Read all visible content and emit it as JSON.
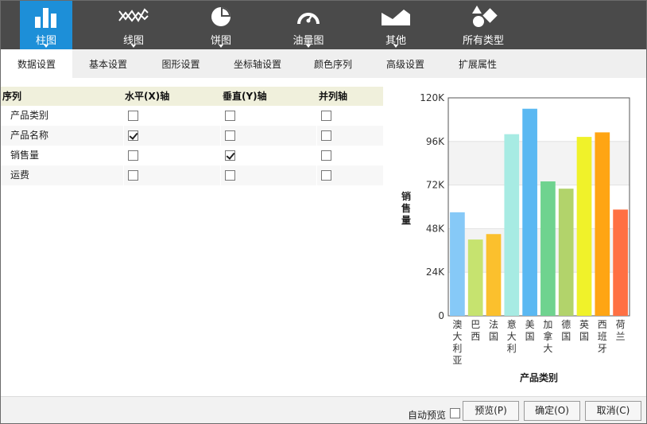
{
  "toolbar": {
    "items": [
      {
        "label": "柱图",
        "icon": "bar-chart-icon",
        "active": true
      },
      {
        "label": "线图",
        "icon": "line-chart-icon",
        "active": false
      },
      {
        "label": "饼图",
        "icon": "pie-chart-icon",
        "active": false
      },
      {
        "label": "油量图",
        "icon": "gauge-chart-icon",
        "active": false
      },
      {
        "label": "其他",
        "icon": "area-chart-icon",
        "active": false
      },
      {
        "label": "所有类型",
        "icon": "shapes-icon",
        "active": false
      }
    ]
  },
  "tabs": [
    {
      "label": "数据设置",
      "active": true
    },
    {
      "label": "基本设置",
      "active": false
    },
    {
      "label": "图形设置",
      "active": false
    },
    {
      "label": "坐标轴设置",
      "active": false
    },
    {
      "label": "颜色序列",
      "active": false
    },
    {
      "label": "高级设置",
      "active": false
    },
    {
      "label": "扩展属性",
      "active": false
    }
  ],
  "grid": {
    "headers": [
      "序列",
      "水平(X)轴",
      "垂直(Y)轴",
      "并列轴"
    ],
    "rows": [
      {
        "name": "产品类别",
        "x": false,
        "y": false,
        "parallel": false
      },
      {
        "name": "产品名称",
        "x": true,
        "y": false,
        "parallel": false
      },
      {
        "name": "销售量",
        "x": false,
        "y": true,
        "parallel": false
      },
      {
        "name": "运费",
        "x": false,
        "y": false,
        "parallel": false
      }
    ]
  },
  "chart_data": {
    "type": "bar",
    "categories": [
      "澳大利亚",
      "巴西",
      "法国",
      "意大利",
      "美国",
      "加拿大",
      "德国",
      "英国",
      "西班牙",
      "荷兰"
    ],
    "values": [
      57000,
      42000,
      45000,
      100000,
      114000,
      74000,
      70000,
      98500,
      101000,
      58500
    ],
    "colors": [
      "#86c9f7",
      "#c6e36f",
      "#fbc02d",
      "#a7ebe3",
      "#5ab8f2",
      "#6fd38f",
      "#b2d36b",
      "#f0f22a",
      "#ffa513",
      "#ff7043"
    ],
    "ylim": [
      0,
      120000
    ],
    "yticks": [
      0,
      24000,
      48000,
      72000,
      96000,
      120000
    ],
    "ytick_labels": [
      "0",
      "24K",
      "48K",
      "72K",
      "96K",
      "120K"
    ],
    "xlabel": "产品类别",
    "ylabel": "销售量",
    "grid": true,
    "alternating_bands": true
  },
  "footer": {
    "auto_preview_label": "自动预览",
    "auto_preview_checked": false,
    "preview_button": "预览(P)",
    "ok_button": "确定(O)",
    "cancel_button": "取消(C)"
  }
}
